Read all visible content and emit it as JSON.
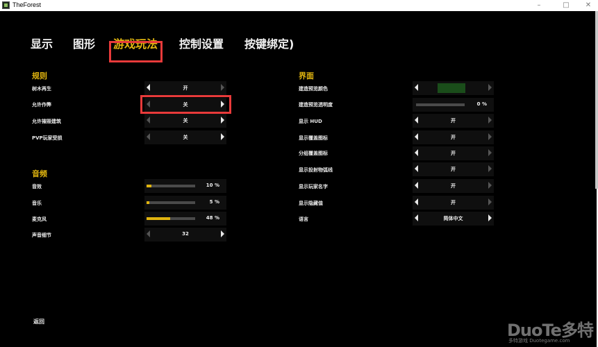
{
  "window": {
    "title": "TheForest",
    "minimize": "–",
    "maximize": "□",
    "close": "✕"
  },
  "tabs": [
    {
      "label": "显示"
    },
    {
      "label": "图形"
    },
    {
      "label": "游戏玩法"
    },
    {
      "label": "控制设置"
    },
    {
      "label": "按键绑定)"
    }
  ],
  "sections": {
    "rules": "规则",
    "audio": "音频",
    "interface": "界面"
  },
  "rules": [
    {
      "label": "树木再生",
      "value": "开"
    },
    {
      "label": "允许作弊",
      "value": "关"
    },
    {
      "label": "允许摧毁建筑",
      "value": "关"
    },
    {
      "label": "PVP玩家受损",
      "value": "关"
    }
  ],
  "audio": [
    {
      "label": "音效",
      "value_text": "10 %",
      "percent": 10
    },
    {
      "label": "音乐",
      "value_text": "5 %",
      "percent": 5
    },
    {
      "label": "麦克风",
      "value_text": "48 %",
      "percent": 48
    },
    {
      "label": "声音细节",
      "value": "32"
    }
  ],
  "interface": [
    {
      "label": "建造预览颜色"
    },
    {
      "label": "建造预览透明度",
      "value_text": "0 %",
      "percent": 0
    },
    {
      "label": "显示 HUD",
      "value": "开"
    },
    {
      "label": "显示覆盖图标",
      "value": "开"
    },
    {
      "label": "分组覆盖图标",
      "value": "开"
    },
    {
      "label": "显示投射物弧线",
      "value": "开"
    },
    {
      "label": "显示玩家名字",
      "value": "开"
    },
    {
      "label": "显示隐藏值",
      "value": "开"
    },
    {
      "label": "语言",
      "value": "简体中文"
    }
  ],
  "back": "返回",
  "watermark": {
    "logo": "DuoTe多特",
    "sub": "多特游戏 Duotegame.com"
  },
  "colors": {
    "accent": "#e0b40f",
    "highlight": "#e83a3a",
    "preview_color": "#1a4d1a"
  }
}
